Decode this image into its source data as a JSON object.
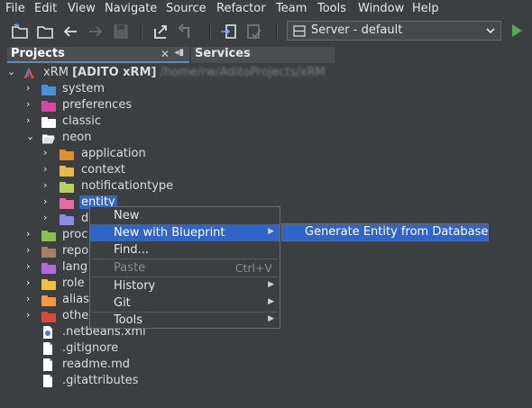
{
  "menubar": {
    "items": [
      "File",
      "Edit",
      "View",
      "Navigate",
      "Source",
      "Refactor",
      "Team",
      "Tools",
      "Window",
      "Help"
    ]
  },
  "toolbar": {
    "buttons": [
      "new-project-icon",
      "open-project-icon",
      "back-icon",
      "forward-icon",
      "save-all-icon",
      "export-icon",
      "undo-icon",
      "deploy-icon",
      "checklist-icon"
    ],
    "server_combo": {
      "label": "Server - default"
    },
    "run_color": "#4caf50"
  },
  "tabs": {
    "projects": "Projects",
    "services": "Services"
  },
  "tree": {
    "root": {
      "name": "xRM",
      "bracket": "[ADITO xRM]",
      "path": "/home/rw/AditoProjects/xRM"
    },
    "items": [
      {
        "label": "system",
        "color": "#4a90d9"
      },
      {
        "label": "preferences",
        "color": "#d946a8"
      },
      {
        "label": "classic",
        "color": "#ffffff"
      },
      {
        "label": "neon",
        "color": "#ffffff",
        "open": true
      },
      {
        "label": "application",
        "color": "#e0902a"
      },
      {
        "label": "context",
        "color": "#e8b84a"
      },
      {
        "label": "notificationtype",
        "color": "#b9cf5e"
      },
      {
        "label": "entity",
        "color": "#e868a8",
        "selected": true
      },
      {
        "label": "d",
        "color": "#8a8ae8"
      },
      {
        "label": "proc",
        "color": "#8bc34a"
      },
      {
        "label": "repo",
        "color": "#a0806c"
      },
      {
        "label": "lang",
        "color": "#b06ad9"
      },
      {
        "label": "role",
        "color": "#f0c040"
      },
      {
        "label": "alias",
        "color": "#f09a4a"
      },
      {
        "label": "othe",
        "color": "#d64a3a"
      },
      {
        "label": ".netbeans.xml"
      },
      {
        "label": ".gitignore"
      },
      {
        "label": "readme.md"
      },
      {
        "label": ".gitattributes"
      }
    ]
  },
  "context_menu": {
    "items": [
      {
        "label": "New"
      },
      {
        "label": "New with Blueprint",
        "submenu": true
      },
      {
        "label": "Find..."
      },
      {
        "label": "Paste",
        "shortcut": "Ctrl+V",
        "disabled": true
      },
      {
        "label": "History",
        "submenu": true
      },
      {
        "label": "Git",
        "submenu": true
      },
      {
        "label": "Tools",
        "submenu": true
      }
    ],
    "submenu_item": "Generate Entity from Database"
  },
  "colors": {
    "background": "#3c3f41",
    "selection": "#2f65ca",
    "menu_highlight": "#2f65ca"
  }
}
